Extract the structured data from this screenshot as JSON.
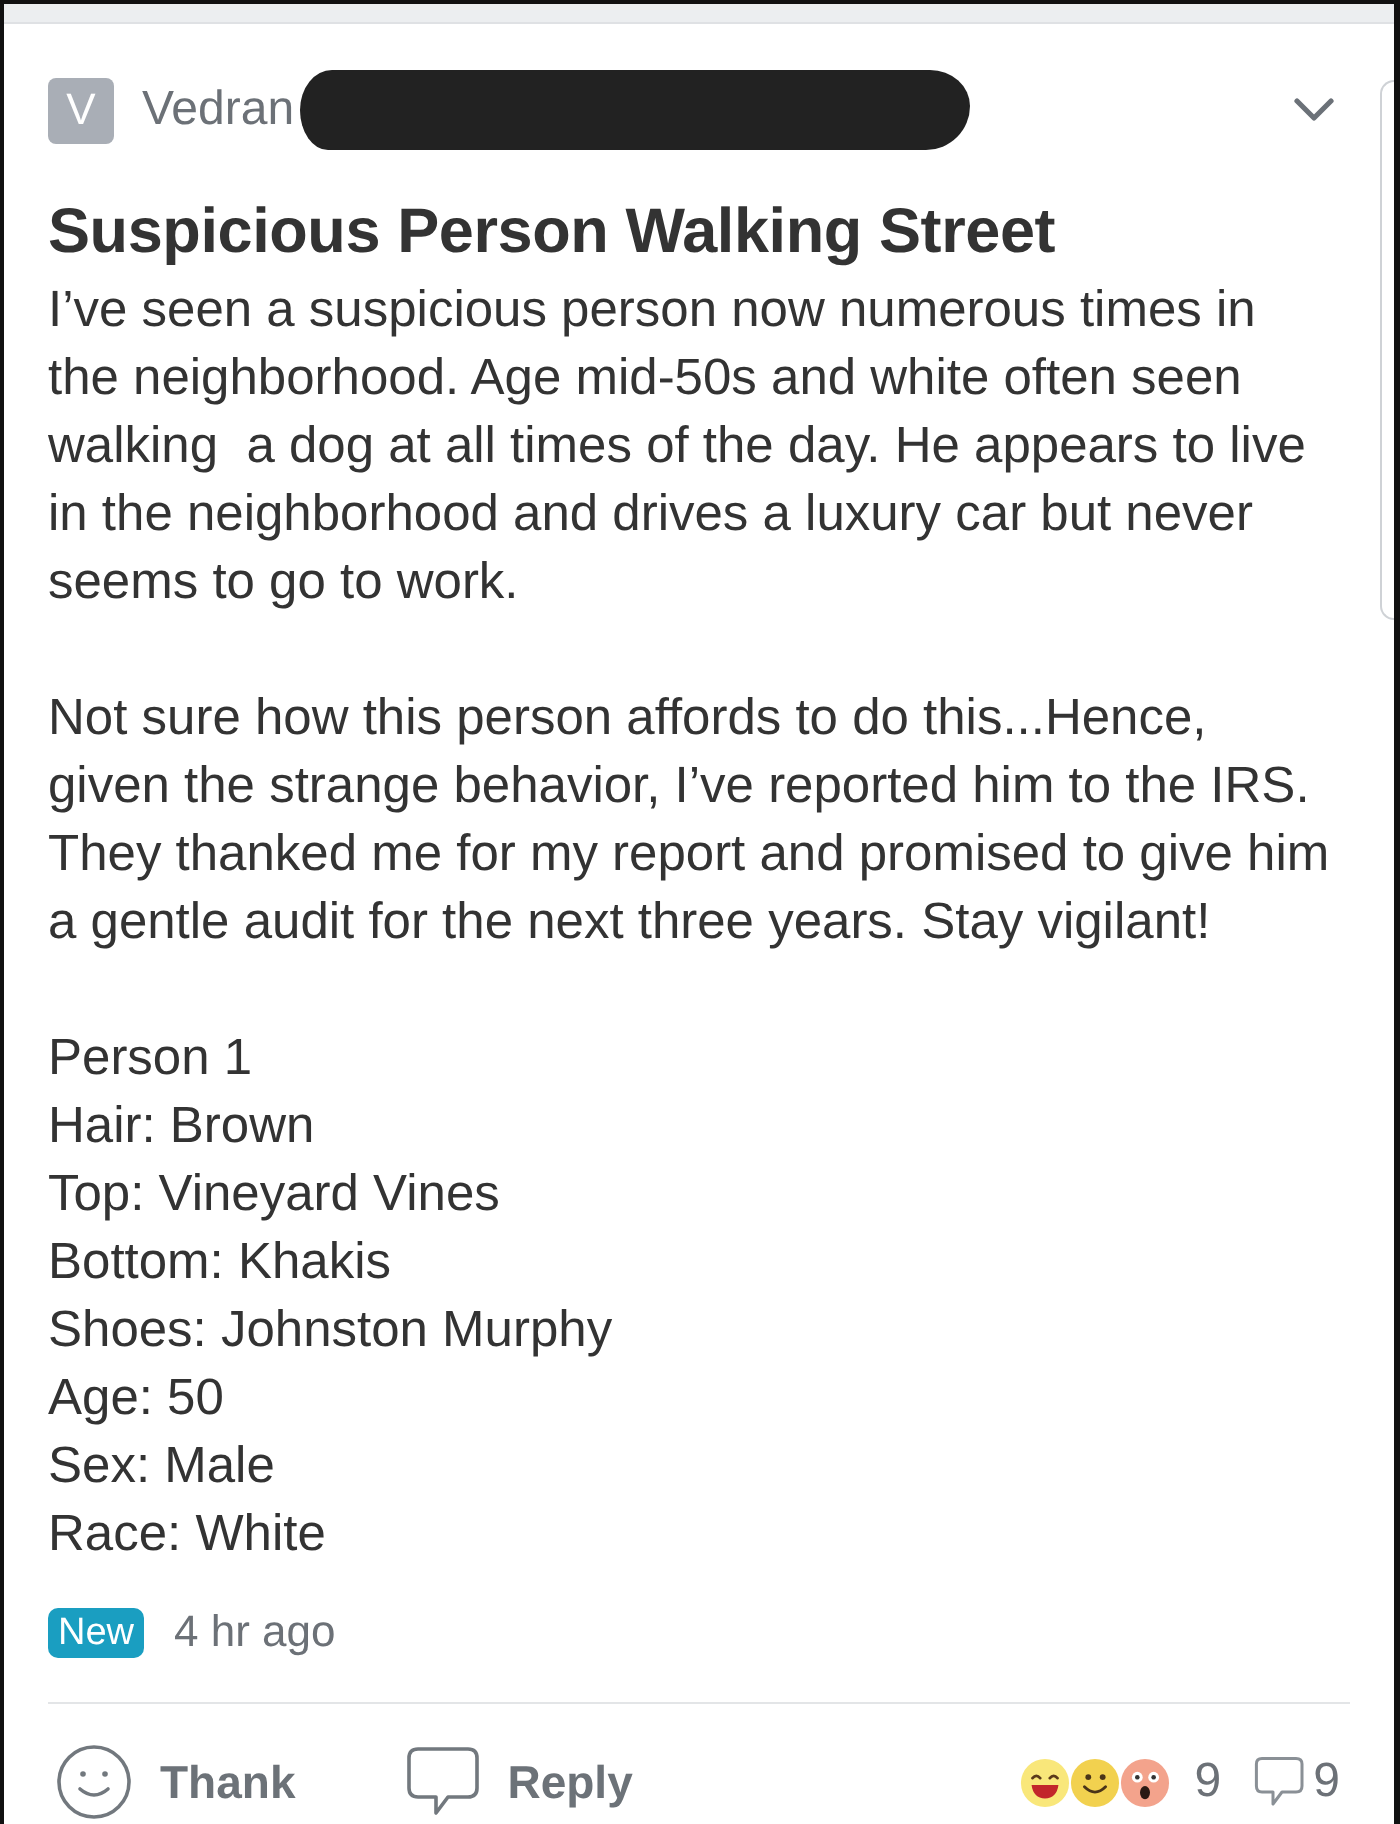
{
  "author": {
    "initial": "V",
    "name": "Vedran",
    "redacted": true
  },
  "post": {
    "title": "Suspicious Person Walking Street",
    "paragraphs": [
      "I’ve seen a suspicious person now numerous times in\nthe neighborhood. Age mid-50s and white often seen\nwalking  a dog at all times of the day. He appears to live\nin the neighborhood and drives a luxury car but never\nseems to go to work.",
      "Not sure how this person affords to do this...Hence,\ngiven the strange behavior, I’ve reported him to the IRS.\nThey thanked me for my report and promised to give him\na gentle audit for the next three years. Stay vigilant!"
    ],
    "details": [
      "Person 1",
      "Hair: Brown",
      "Top: Vineyard Vines",
      "Bottom: Khakis",
      "Shoes: Johnston Murphy",
      "Age: 50",
      "Sex: Male",
      "Race: White"
    ]
  },
  "meta": {
    "badge": "New",
    "time": "4 hr ago"
  },
  "actions": [
    {
      "kind": "thank",
      "label": "Thank"
    },
    {
      "kind": "reply",
      "label": "Reply"
    }
  ],
  "stats": {
    "reactions": "9",
    "replies": "9"
  }
}
